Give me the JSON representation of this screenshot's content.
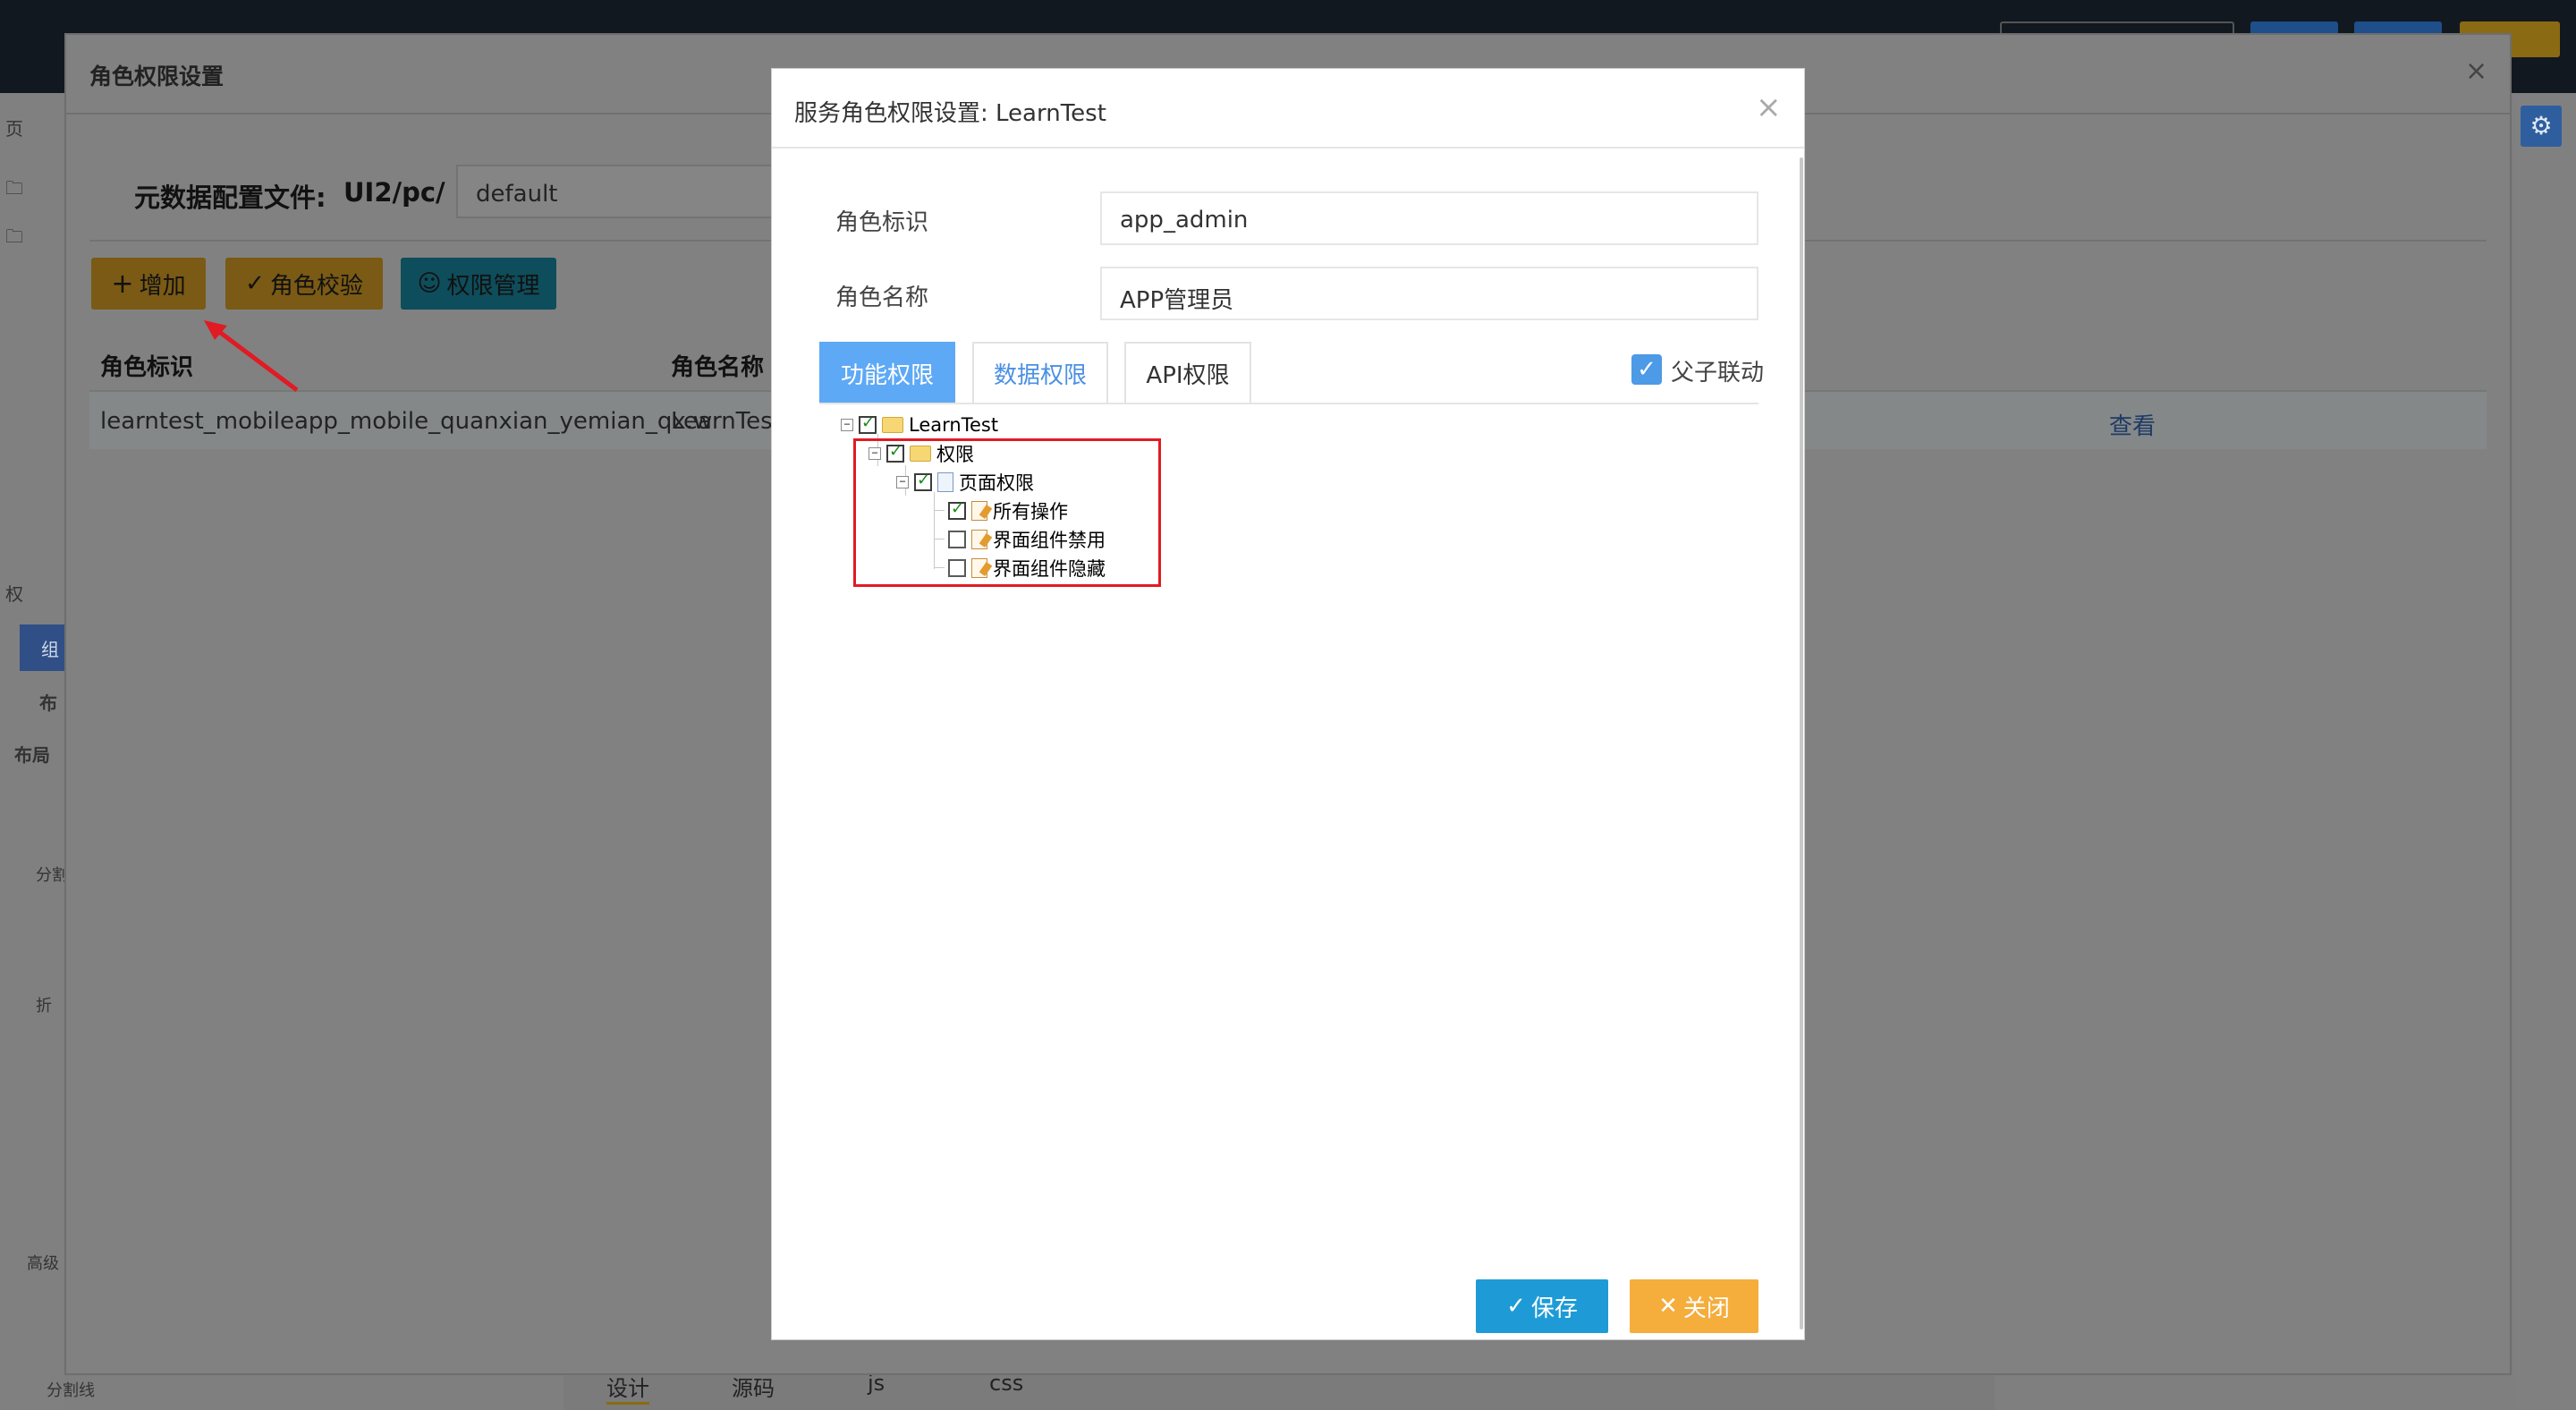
{
  "background": {
    "left_labels": [
      "页",
      "权",
      "组",
      "布",
      "布局",
      "分割",
      "折",
      "高级",
      "分割线"
    ],
    "bottom_tabs": [
      "设计",
      "源码",
      "js",
      "css"
    ]
  },
  "outer_dialog": {
    "title": "角色权限设置",
    "close_glyph": "×",
    "meta_label": "元数据配置文件:",
    "meta_path": "UI2/pc/",
    "meta_value": "default",
    "buttons": {
      "add": "增加",
      "check": "角色校验",
      "manage": "权限管理"
    },
    "columns": [
      "角色标识",
      "角色名称"
    ],
    "rows": [
      {
        "id": "learntest_mobileapp_mobile_quanxian_yemian_qx.w",
        "name": "LearnTest",
        "action": "查看"
      }
    ]
  },
  "dialog": {
    "title": "服务角色权限设置: LearnTest",
    "close_glyph": "×",
    "fields": {
      "role_id_label": "角色标识",
      "role_id_value": "app_admin",
      "role_name_label": "角色名称",
      "role_name_value": "APP管理员"
    },
    "tabs": [
      "功能权限",
      "数据权限",
      "API权限"
    ],
    "linkage_label": "父子联动",
    "linkage_checked": true,
    "tree": {
      "root": "LearnTest",
      "level1": "权限",
      "level2": "页面权限",
      "leaves": [
        {
          "label": "所有操作",
          "checked": true
        },
        {
          "label": "界面组件禁用",
          "checked": false
        },
        {
          "label": "界面组件隐藏",
          "checked": false
        }
      ]
    },
    "save_label": "保存",
    "close_label": "关闭"
  },
  "colors": {
    "primary_blue": "#1e9bd7",
    "tab_active": "#5ea9f5",
    "close_orange": "#f5ad3c",
    "highlight_red": "#e01b24"
  }
}
